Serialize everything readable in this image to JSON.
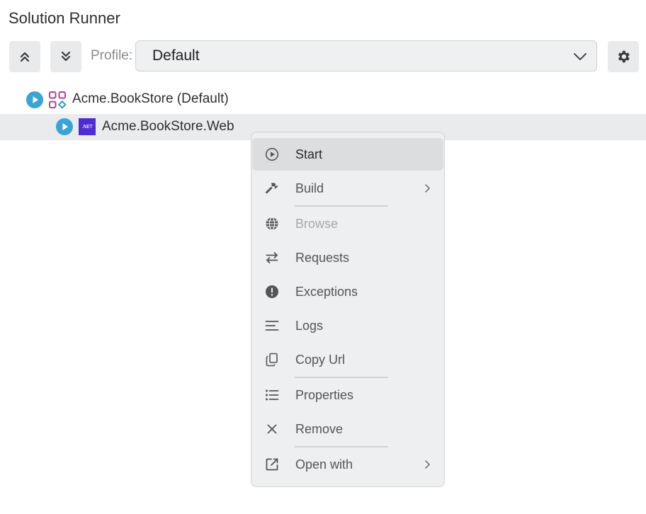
{
  "title": "Solution Runner",
  "toolbar": {
    "collapse_icon": "chevrons-up-icon",
    "expand_icon": "chevrons-down-icon",
    "profile_label": "Profile:",
    "profile_value": "Default",
    "settings_icon": "gear-icon"
  },
  "tree": {
    "solution": {
      "label": "Acme.BookStore (Default)",
      "icon": "solution-icon"
    },
    "project": {
      "label": "Acme.BookStore.Web",
      "badge": ".NET"
    }
  },
  "context_menu": {
    "items": [
      {
        "label": "Start",
        "icon": "play-circle-icon"
      },
      {
        "label": "Build",
        "icon": "hammer-icon"
      },
      {
        "label": "Browse",
        "icon": "globe-icon"
      },
      {
        "label": "Requests",
        "icon": "swap-arrows-icon"
      },
      {
        "label": "Exceptions",
        "icon": "exclamation-circle-icon"
      },
      {
        "label": "Logs",
        "icon": "lines-icon"
      },
      {
        "label": "Copy Url",
        "icon": "copy-icon"
      },
      {
        "label": "Properties",
        "icon": "list-icon"
      },
      {
        "label": "Remove",
        "icon": "close-icon"
      },
      {
        "label": "Open with",
        "icon": "external-link-icon"
      }
    ]
  },
  "colors": {
    "play": "#3ba3d6",
    "dotnet": "#512bd4",
    "solution_pink": "#b2438f",
    "solution_blue": "#2b9fd8"
  }
}
